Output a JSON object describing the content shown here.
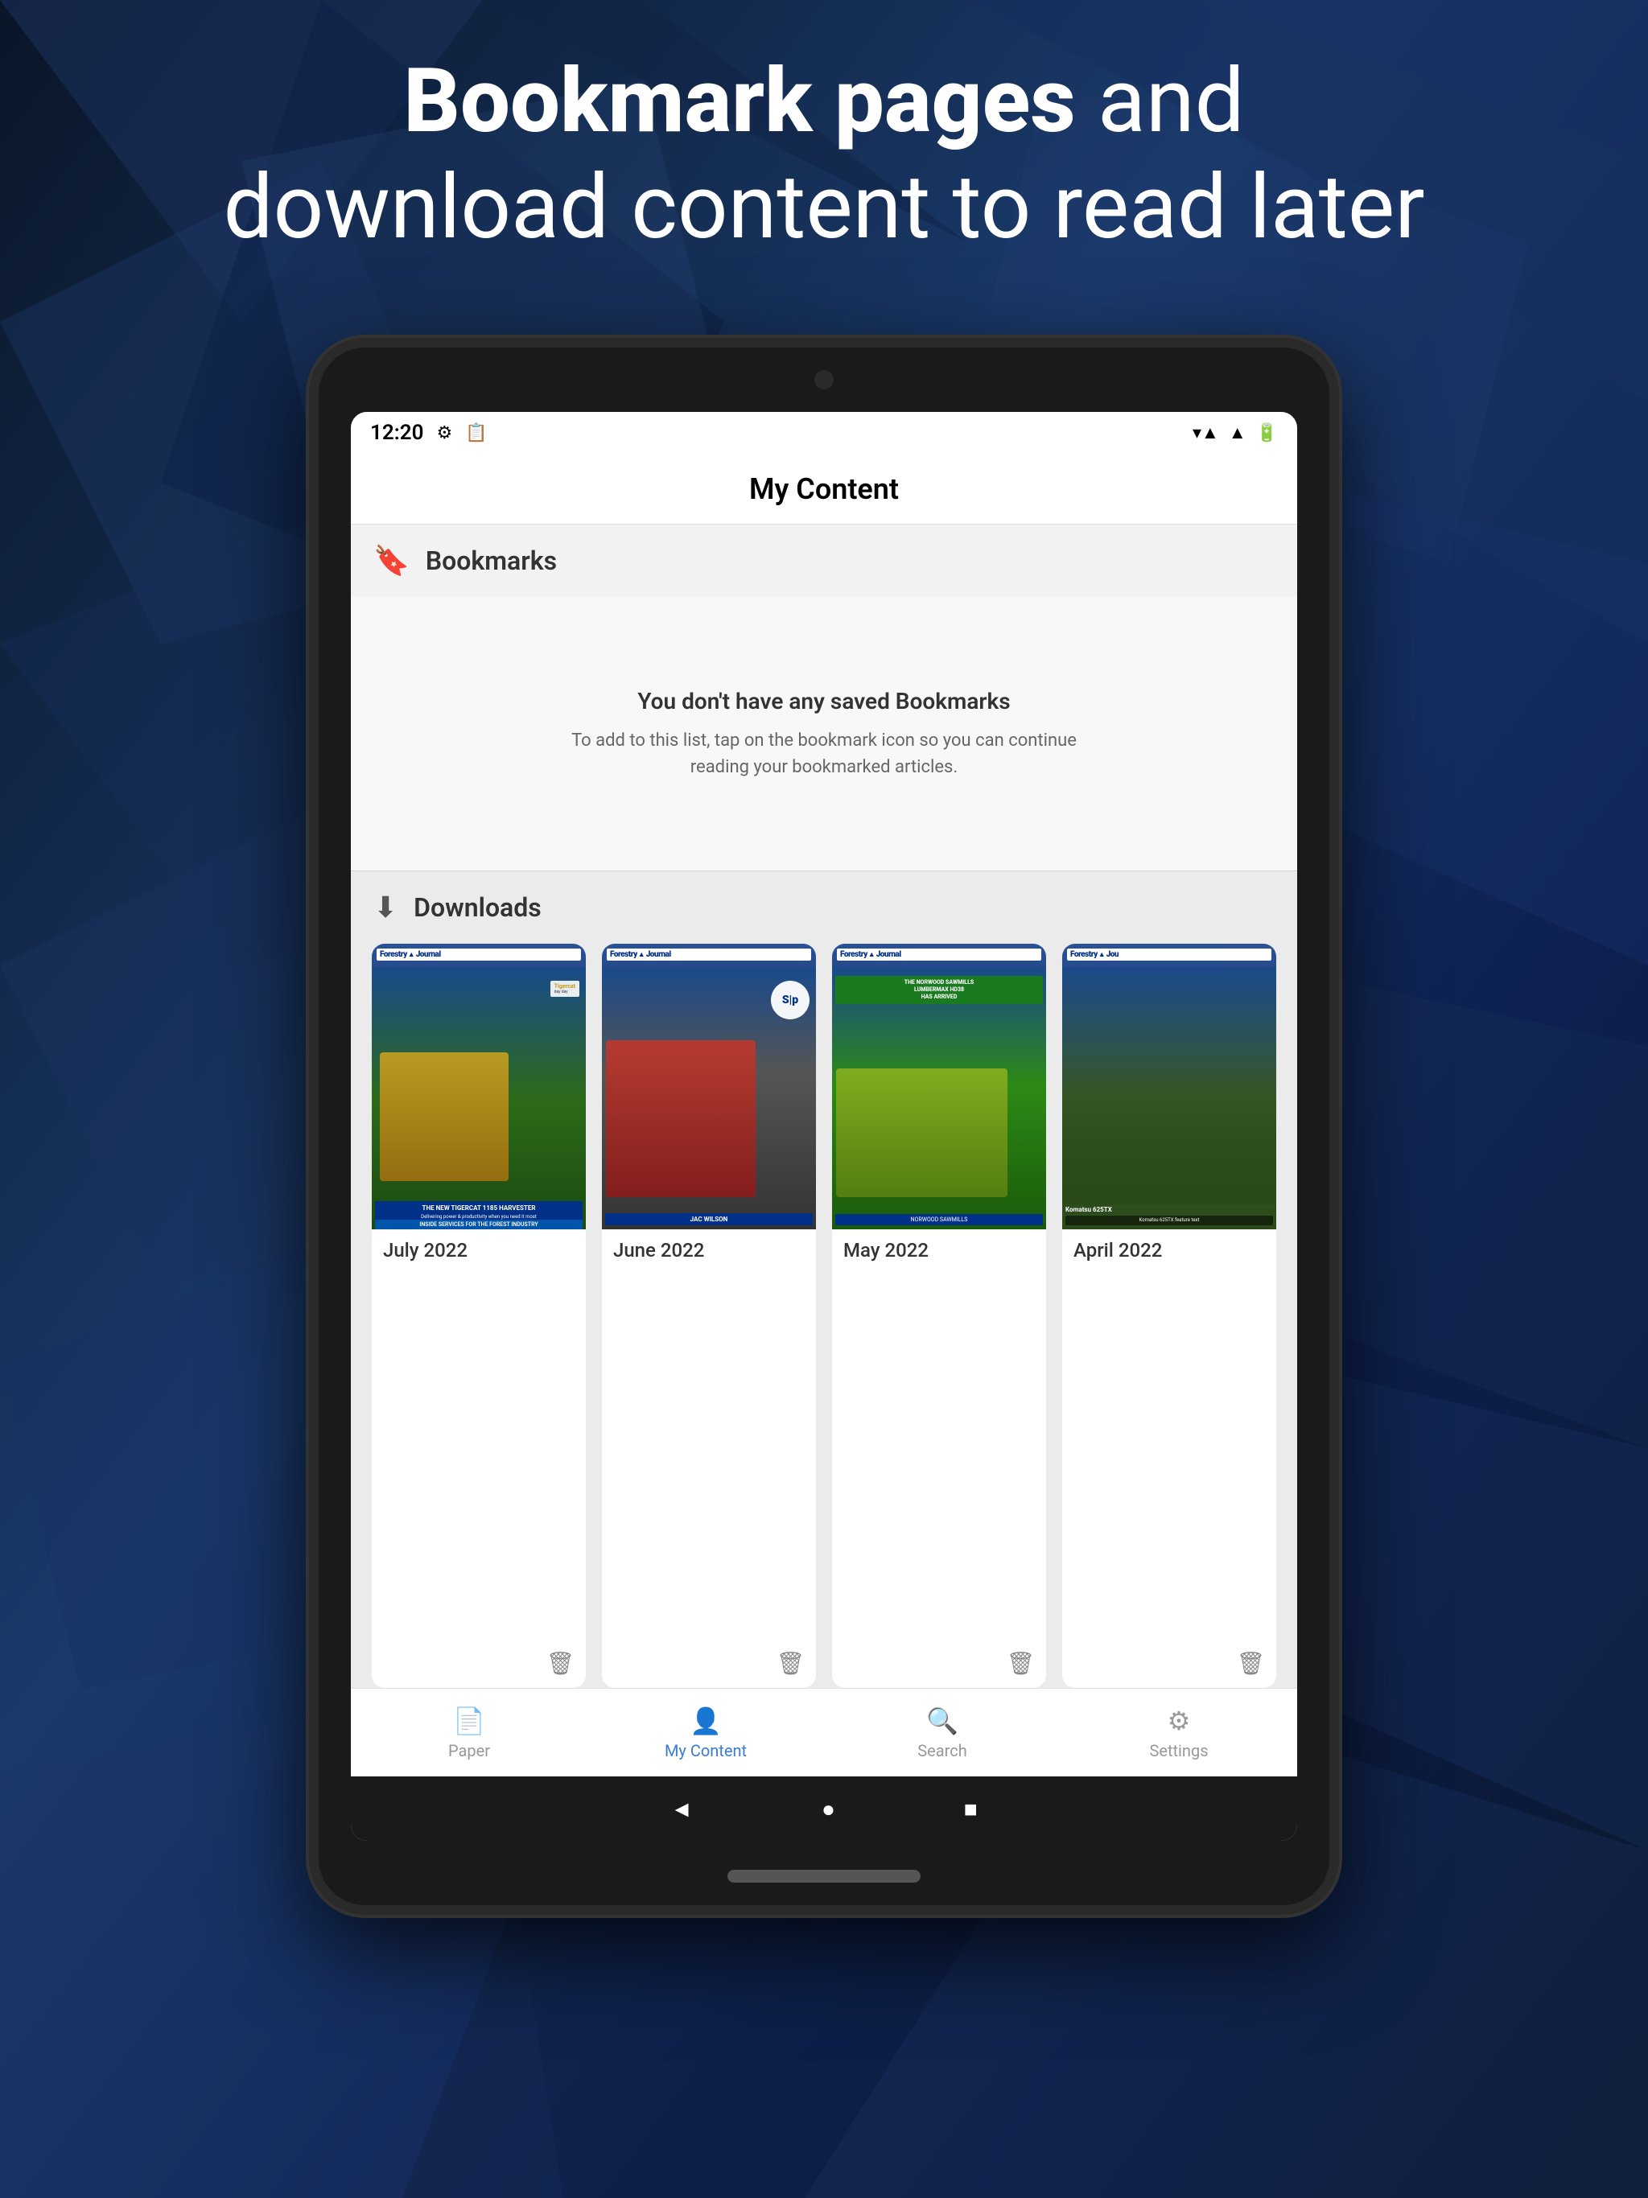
{
  "page": {
    "heading_bold": "Bookmark pages",
    "heading_normal": " and\ndownload content",
    "heading_end": " to read later"
  },
  "status_bar": {
    "time": "12:20",
    "icons": [
      "⚙",
      "📋",
      "▾",
      "▲",
      "🔋"
    ]
  },
  "app": {
    "title": "My Content"
  },
  "bookmarks": {
    "section_label": "Bookmarks",
    "empty_title": "You don't have any saved Bookmarks",
    "empty_desc": "To add to this list, tap on the bookmark icon so you can continue reading your bookmarked articles."
  },
  "downloads": {
    "section_label": "Downloads",
    "magazines": [
      {
        "id": "july-2022",
        "date": "July 2022",
        "cover_color": "july",
        "headline": "THE NEW TIGERCAT 1185 HARVESTER"
      },
      {
        "id": "june-2022",
        "date": "June 2022",
        "cover_color": "june",
        "headline": "JAC WILSON"
      },
      {
        "id": "may-2022",
        "date": "May 2022",
        "cover_color": "may",
        "headline": "THE NORWOOD SAWMILLS LUMBERMAX HD38 HAS ARRIVED"
      },
      {
        "id": "april-2022",
        "date": "April 2022",
        "cover_color": "april",
        "headline": "Komatsu 625TX"
      }
    ]
  },
  "bottom_nav": {
    "items": [
      {
        "id": "paper",
        "label": "Paper",
        "active": false
      },
      {
        "id": "my-content",
        "label": "My Content",
        "active": true
      },
      {
        "id": "search",
        "label": "Search",
        "active": false
      },
      {
        "id": "settings",
        "label": "Settings",
        "active": false
      }
    ]
  }
}
